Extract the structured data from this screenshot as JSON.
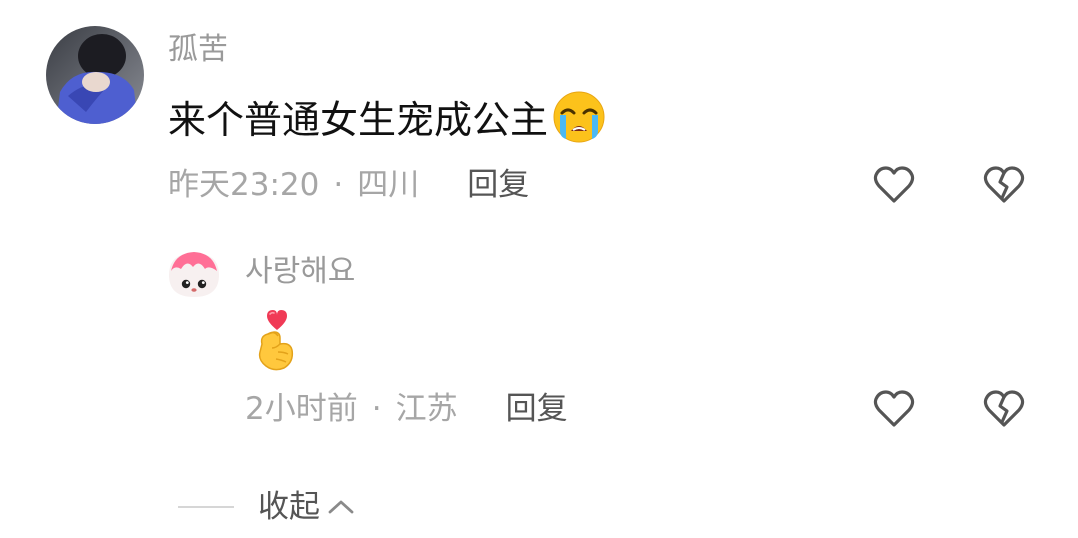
{
  "comment": {
    "username": "孤苦",
    "text": "来个普通女生宠成公主",
    "emoji_icon": "loudly-crying-face-icon",
    "time": "昨天23:20",
    "separator": "·",
    "location": "四川",
    "reply_label": "回复",
    "like_icon": "heart-outline-icon",
    "dislike_icon": "broken-heart-icon"
  },
  "reply": {
    "username": "사랑해요",
    "emoji_icon": "finger-heart-icon",
    "time": "2小时前",
    "separator": "·",
    "location": "江苏",
    "reply_label": "回复",
    "like_icon": "heart-outline-icon",
    "dislike_icon": "broken-heart-icon"
  },
  "collapse": {
    "label": "收起",
    "icon": "chevron-up-icon"
  },
  "colors": {
    "username": "#9a9a9a",
    "meta": "#a6a6a6",
    "reply": "#555555",
    "icon_stroke": "#555555"
  }
}
